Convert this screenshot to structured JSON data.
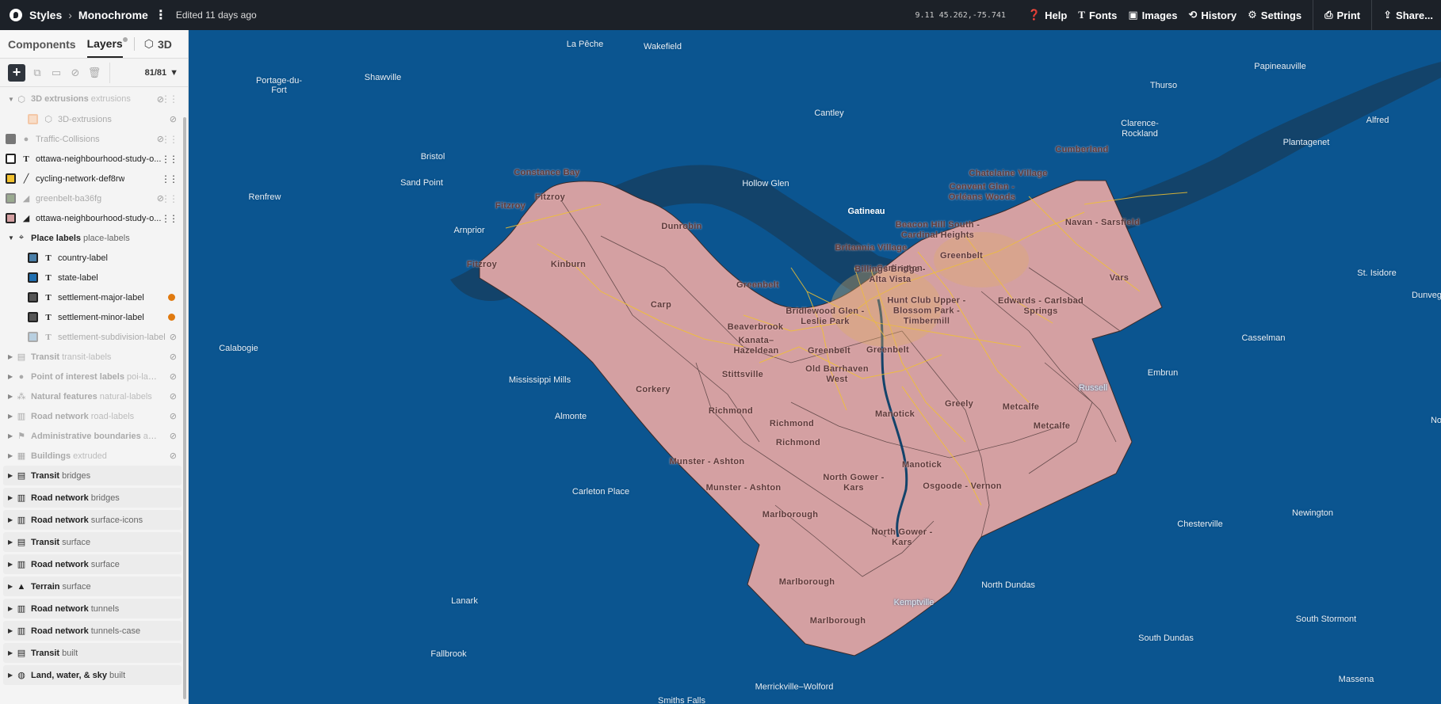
{
  "topbar": {
    "app": "Styles",
    "style_name": "Monochrome",
    "edited": "Edited 11 days ago",
    "coords": "9.11 45.262,-75.741",
    "help": "Help",
    "fonts": "Fonts",
    "images": "Images",
    "history": "History",
    "settings": "Settings",
    "print": "Print",
    "share": "Share..."
  },
  "sidebar": {
    "tab_components": "Components",
    "tab_layers": "Layers",
    "tab_3d": "3D",
    "layer_count": "81/81",
    "layers": [
      {
        "name": "3D extrusions",
        "sub": "extrusions"
      },
      {
        "name": "3D-extrusions"
      },
      {
        "name": "Traffic-Collisions"
      },
      {
        "name": "ottawa-neighbourhood-study-o..."
      },
      {
        "name": "cycling-network-def8rw"
      },
      {
        "name": "greenbelt-ba36fg"
      },
      {
        "name": "ottawa-neighbourhood-study-o..."
      },
      {
        "name": "Place labels",
        "sub": "place-labels"
      },
      {
        "name": "country-label"
      },
      {
        "name": "state-label"
      },
      {
        "name": "settlement-major-label"
      },
      {
        "name": "settlement-minor-label"
      },
      {
        "name": "settlement-subdivision-label"
      },
      {
        "name": "Transit",
        "sub": "transit-labels"
      },
      {
        "name": "Point of interest labels",
        "sub": "poi-lab..."
      },
      {
        "name": "Natural features",
        "sub": "natural-labels"
      },
      {
        "name": "Road network",
        "sub": "road-labels"
      },
      {
        "name": "Administrative boundaries",
        "sub": "ad..."
      },
      {
        "name": "Buildings",
        "sub": "extruded"
      },
      {
        "name": "Transit",
        "sub": "bridges"
      },
      {
        "name": "Road network",
        "sub": "bridges"
      },
      {
        "name": "Road network",
        "sub": "surface-icons"
      },
      {
        "name": "Transit",
        "sub": "surface"
      },
      {
        "name": "Road network",
        "sub": "surface"
      },
      {
        "name": "Terrain",
        "sub": "surface"
      },
      {
        "name": "Road network",
        "sub": "tunnels"
      },
      {
        "name": "Road network",
        "sub": "tunnels-case"
      },
      {
        "name": "Transit",
        "sub": "built"
      },
      {
        "name": "Land, water, & sky",
        "sub": "built"
      }
    ]
  },
  "colors": {
    "water": "#0b5590",
    "land": "#0e5a93",
    "ottawa_fill": "#d4a0a2",
    "cycling": "#f2c230",
    "topbar": "#1c2128",
    "accent_dot": "#e07a10"
  },
  "map": {
    "base_labels": [
      "La Pêche",
      "Wakefield",
      "Shawville",
      "Portage-du-Fort",
      "Cantley",
      "Bristol",
      "Sand Point",
      "Renfrew",
      "Hollow Glen",
      "Arnprior",
      "Gatineau",
      "Thurso",
      "Papineauville",
      "Clarence-Rockland",
      "Alfred",
      "Plantagenet",
      "Calabogie",
      "Mississippi Mills",
      "Almonte",
      "Carleton Place",
      "Lanark",
      "Fallbrook",
      "Merrickville–Wolford",
      "Smiths Falls",
      "Kemptville",
      "North Dundas",
      "South Dundas",
      "Chesterville",
      "Newington",
      "Casselman",
      "Embrun",
      "Russell",
      "St. Isidore",
      "Dunveg",
      "South Stormont",
      "Massena",
      "No"
    ],
    "ottawa_labels": [
      "Constance Bay",
      "Fitzroy",
      "Dunrobin",
      "Kinburn",
      "Carp",
      "Fitzroy",
      "Fitzroy",
      "Greenbelt",
      "Beaverbrook",
      "Kanata–Hazeldean",
      "Stittsville",
      "Corkery",
      "Richmond",
      "Richmond",
      "Richmond",
      "Greenbelt",
      "Greenbelt",
      "Old Barrhaven West",
      "Manotick",
      "Munster - Ashton",
      "Munster - Ashton",
      "North Gower - Kars",
      "Manotick",
      "Marlborough",
      "North Gower - Kars",
      "Marlborough",
      "Marlborough",
      "Osgoode - Vernon",
      "Greely",
      "Metcalfe",
      "Metcalfe",
      "Edwards - Carlsbad Springs",
      "Vars",
      "Navan - Sarsfield",
      "Greenbelt",
      "Convent Glen - Orléans Woods",
      "Chatelaine Village",
      "Cumberland",
      "Britannia Village",
      "Carlington",
      "Billings Bridge - Alta Vista",
      "Hunt Club Upper - Blossom Park - Timbermill",
      "Beacon Hill South - Cardinal Heights",
      "Bridlewood Glen - Leslie Park"
    ]
  }
}
